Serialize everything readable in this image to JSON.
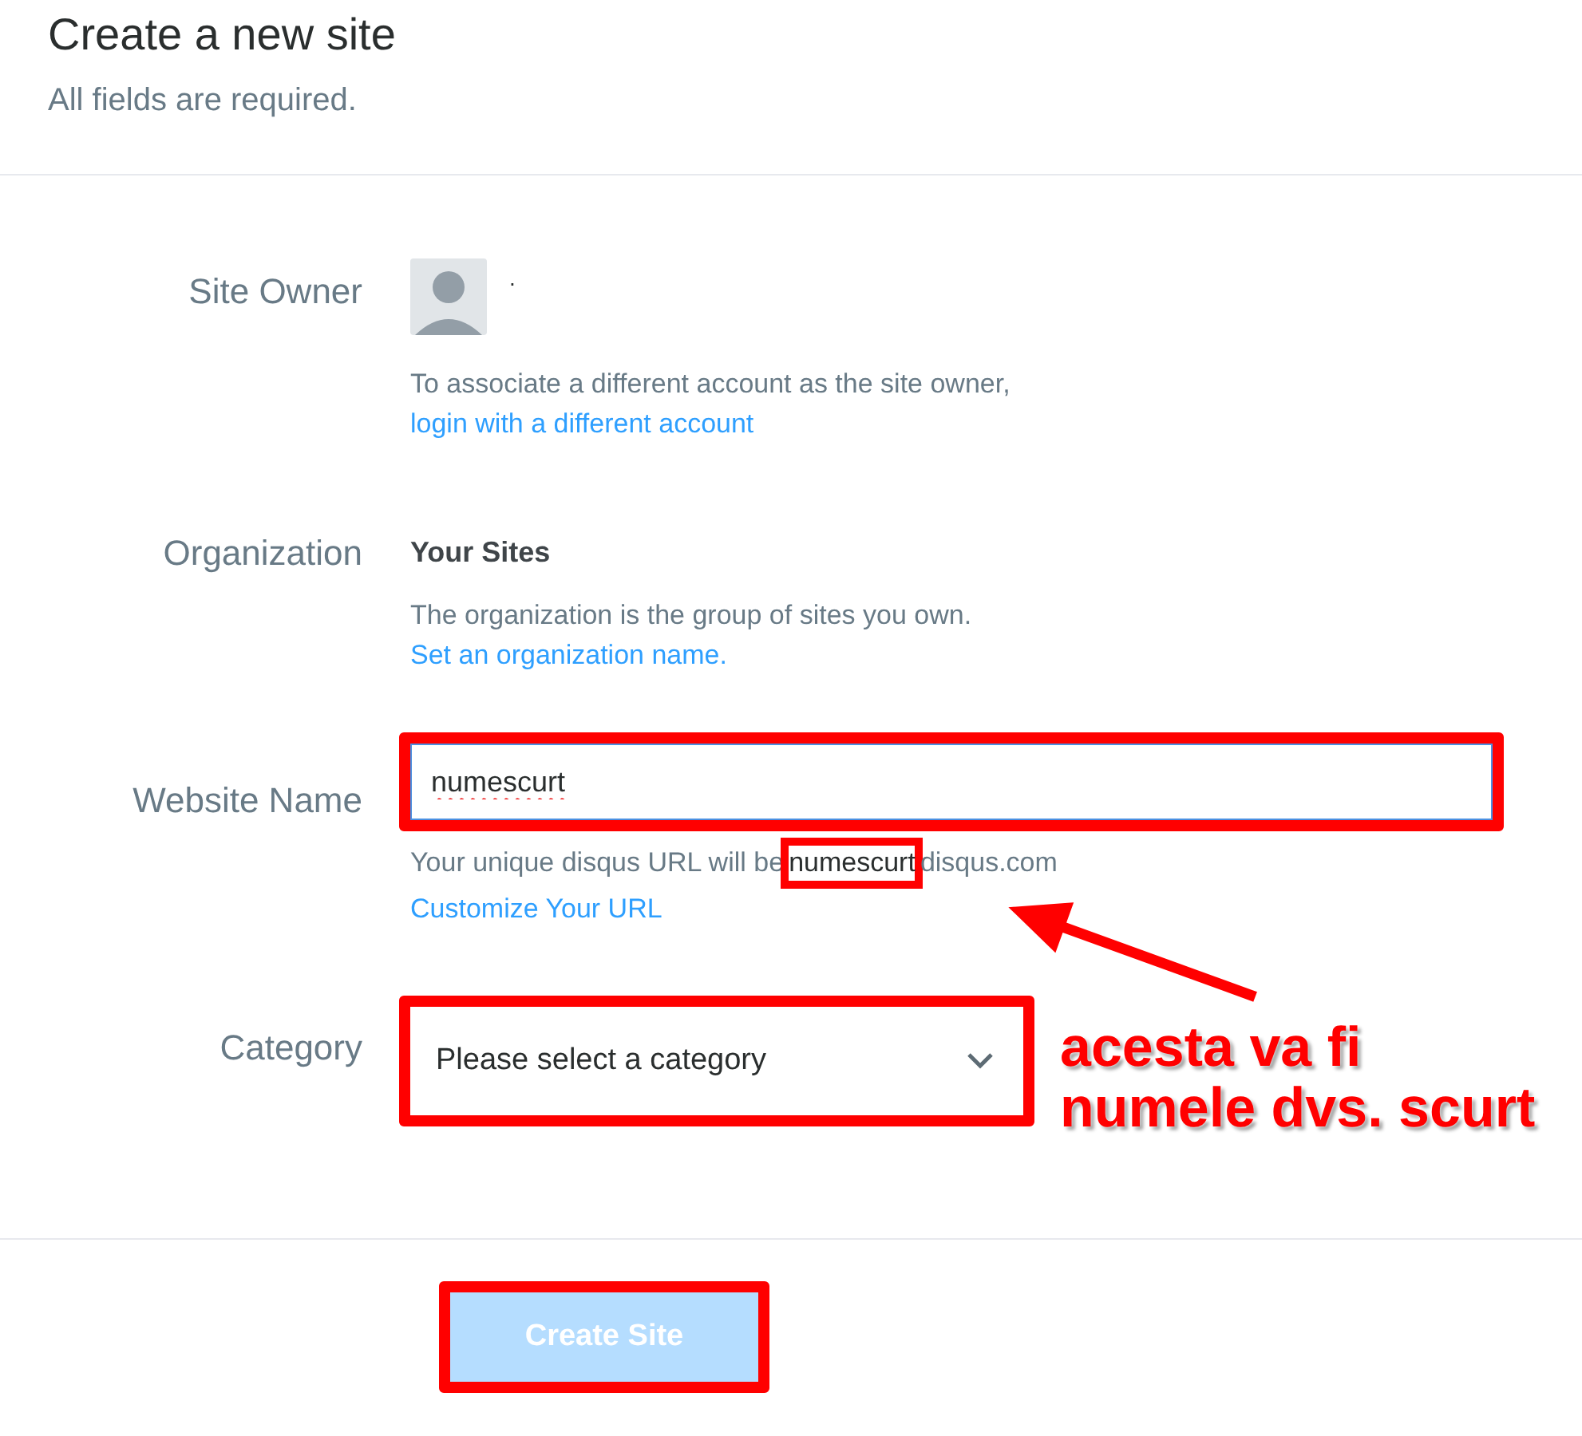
{
  "header": {
    "title": "Create a new site",
    "subtitle": "All fields are required."
  },
  "fields": [
    {
      "kind": "owner",
      "label": "Site Owner",
      "name": ".",
      "note": "To associate a different account as the site owner,",
      "link": "login with a different account"
    },
    {
      "kind": "organization",
      "label": "Organization",
      "value": "Your Sites",
      "note": "The organization is the group of sites you own.",
      "link": "Set an organization name."
    },
    {
      "kind": "text",
      "label": "Website Name",
      "value": "numescurt",
      "note_before": "Your unique disqus URL will be",
      "note_highlight": "numescurt",
      "note_after": "disqus.com",
      "link": "Customize Your URL",
      "highlighted": true
    },
    {
      "kind": "select",
      "label": "Category",
      "value": "Please select a category",
      "highlighted": true
    }
  ],
  "submit": {
    "label": "Create Site",
    "disabled": true,
    "highlighted": true
  },
  "annotation": {
    "lines": [
      "acesta va fi",
      "numele dvs. scurt"
    ]
  }
}
